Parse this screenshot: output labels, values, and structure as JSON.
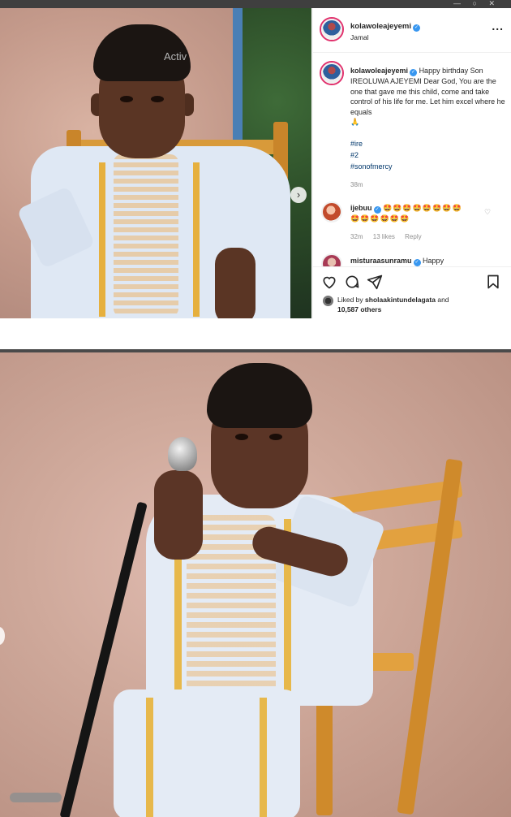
{
  "top_post": {
    "username": "kolawoleajeyemi",
    "location": "Jamal",
    "more_label": "...",
    "caption": {
      "author": "kolawoleajeyemi",
      "text": "Happy birthday Son IREOLUWA AJEYEMI Dear God, You are the one that gave me this child, come and take control of his life for me. Let him excel where he equals",
      "emoji": "🙏",
      "hashtags": [
        "#ire",
        "#2",
        "#sonofmercy"
      ],
      "time": "38m"
    },
    "comments": [
      {
        "author": "ijebuu",
        "emoji_line_1": "🤩🤩🤩🤩🤩🤩🤩🤩",
        "emoji_line_2": "🤩🤩🤩🤩🤩🤩",
        "time": "32m",
        "likes": "13 likes",
        "reply": "Reply"
      },
      {
        "author": "misturaasunramu",
        "text": "Happy"
      }
    ],
    "liked_by": {
      "prefix": "Liked by",
      "user": "sholaakintundelagata",
      "connector": "and",
      "others": "10,587 others"
    },
    "watermark": "Activ",
    "carousel_arrow": "›"
  },
  "icons": {
    "more": "ellipsis-icon",
    "like": "heart-icon",
    "comment": "comment-icon",
    "share": "send-icon",
    "save": "bookmark-icon",
    "verified": "verified-badge-icon",
    "next": "chevron-right-icon"
  },
  "colors": {
    "verified": "#3897f0",
    "hashtag": "#00376b",
    "muted": "#8e8e8e",
    "text": "#262626"
  }
}
